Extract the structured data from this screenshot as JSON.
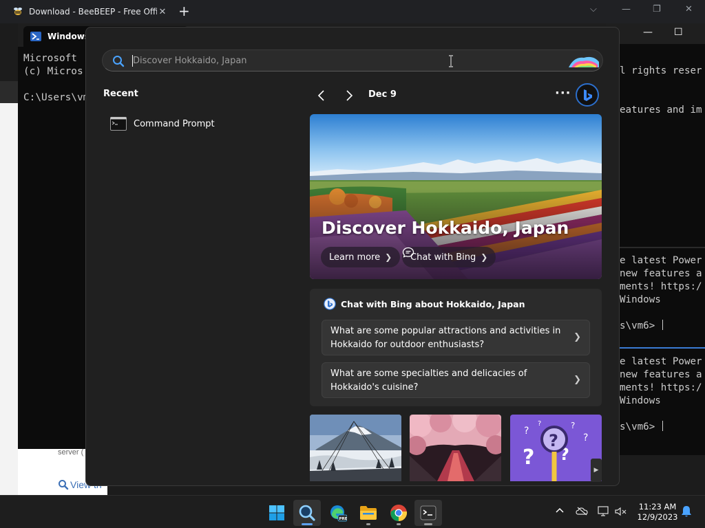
{
  "browser": {
    "tab_title": "Download - BeeBEEP - Free Office",
    "new_tab": "+",
    "page_text": "server (",
    "view_link": "View th"
  },
  "powershell": {
    "tab_title": "Windows",
    "lines": [
      "Microsoft",
      "(c) Micros",
      "",
      "C:\\Users\\vm"
    ]
  },
  "terminal": {
    "top_lines": [
      "l rights reser",
      "",
      "",
      "eatures and im"
    ],
    "pane1_lines": [
      "e latest Power",
      "new features a",
      "ments! https:/",
      "Windows",
      "",
      "s\\vm6> "
    ],
    "pane2_lines": [
      "e latest Power",
      "new features a",
      "ments! https:/",
      "Windows",
      "",
      "s\\vm6> "
    ]
  },
  "search": {
    "placeholder": "Discover Hokkaido, Japan",
    "recent_heading": "Recent",
    "recent_items": [
      {
        "label": "Command Prompt",
        "icon": "command-prompt-icon"
      }
    ],
    "date": "Dec 9",
    "more": "···",
    "hero": {
      "title": "Discover Hokkaido, Japan",
      "learn_more": "Learn more",
      "chat_with_bing": "Chat with Bing"
    },
    "chat_card": {
      "heading": "Chat with Bing about Hokkaido, Japan",
      "suggestions": [
        "What are some popular attractions and activities in Hokkaido for outdoor enthusiasts?",
        "What are some specialties and delicacies of Hokkaido's cuisine?"
      ]
    },
    "thumbnails": [
      "mountain-ropeway",
      "cherry-blossom-tunnel",
      "question-quiz"
    ]
  },
  "taskbar": {
    "icons": [
      "windows-start-icon",
      "search-icon",
      "edge-preview-icon",
      "file-explorer-icon",
      "chrome-icon",
      "terminal-icon"
    ],
    "time": "11:23 AM",
    "date": "12/9/2023"
  },
  "colors": {
    "accent": "#2c6fcc",
    "flyout_bg": "#202020",
    "card_bg": "#2b2b2b",
    "taskbar_bg": "#1e1e1e"
  }
}
